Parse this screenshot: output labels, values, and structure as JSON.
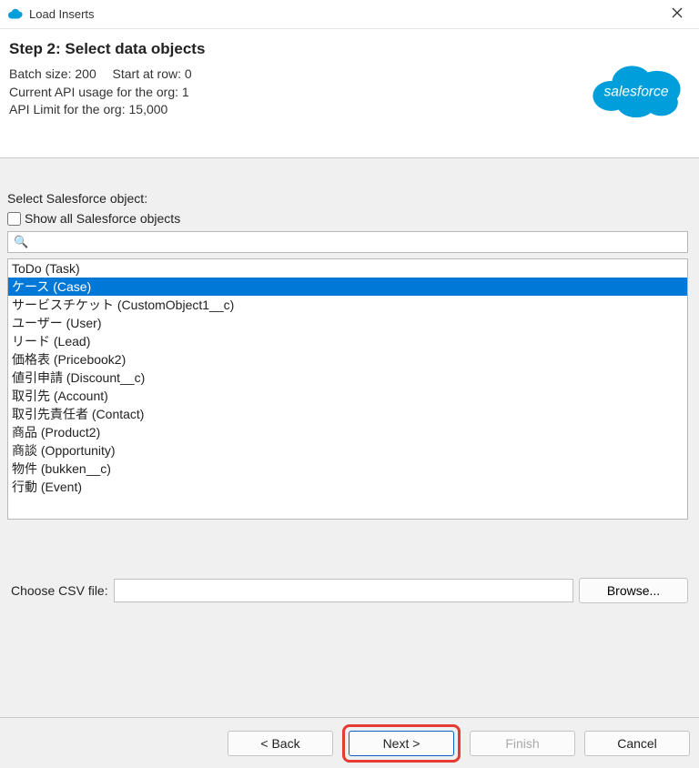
{
  "window": {
    "title": "Load Inserts"
  },
  "header": {
    "step_title": "Step 2: Select data objects",
    "batch_label": "Batch size:",
    "batch_value": "200",
    "start_row_label": "Start at row:",
    "start_row_value": "0",
    "api_usage_label": "Current API usage for the org:",
    "api_usage_value": "1",
    "api_limit_label": "API Limit for the org:",
    "api_limit_value": "15,000"
  },
  "form": {
    "select_label": "Select Salesforce object:",
    "show_all_label": "Show all Salesforce objects",
    "search_value": "",
    "csv_label": "Choose CSV file:",
    "csv_value": ""
  },
  "objects": {
    "items": [
      {
        "label": "ToDo (Task)",
        "selected": false
      },
      {
        "label": "ケース (Case)",
        "selected": true
      },
      {
        "label": "サービスチケット (CustomObject1__c)",
        "selected": false
      },
      {
        "label": "ユーザー (User)",
        "selected": false
      },
      {
        "label": "リード (Lead)",
        "selected": false
      },
      {
        "label": "価格表 (Pricebook2)",
        "selected": false
      },
      {
        "label": "値引申請 (Discount__c)",
        "selected": false
      },
      {
        "label": "取引先 (Account)",
        "selected": false
      },
      {
        "label": "取引先責任者 (Contact)",
        "selected": false
      },
      {
        "label": "商品 (Product2)",
        "selected": false
      },
      {
        "label": "商談 (Opportunity)",
        "selected": false
      },
      {
        "label": "物件 (bukken__c)",
        "selected": false
      },
      {
        "label": "行動 (Event)",
        "selected": false
      }
    ]
  },
  "buttons": {
    "browse": "Browse...",
    "back": "< Back",
    "next": "Next >",
    "finish": "Finish",
    "cancel": "Cancel"
  }
}
